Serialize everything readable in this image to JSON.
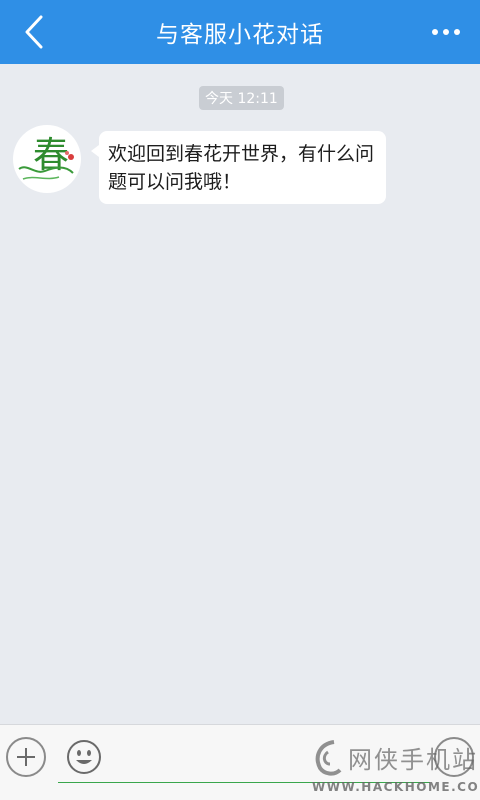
{
  "header": {
    "title": "与客服小花对话",
    "back_icon": "back-chevron-icon",
    "more_icon": "more-dots-icon"
  },
  "chat": {
    "timestamp": "今天 12:11",
    "messages": [
      {
        "sender_avatar": "春",
        "text": "欢迎回到春花开世界，有什么问题可以问我哦！"
      }
    ]
  },
  "input_bar": {
    "plus_icon": "plus-icon",
    "emoji_icon": "smiley-icon",
    "input_value": "",
    "underline_color": "#3aa64c"
  },
  "watermark": {
    "cn": "网侠手机站",
    "en": "WWW.HACKHOME.COM"
  },
  "colors": {
    "header_bg": "#2f8fe6",
    "chat_bg": "#e8ebf0",
    "avatar_green": "#2e8b2e"
  }
}
